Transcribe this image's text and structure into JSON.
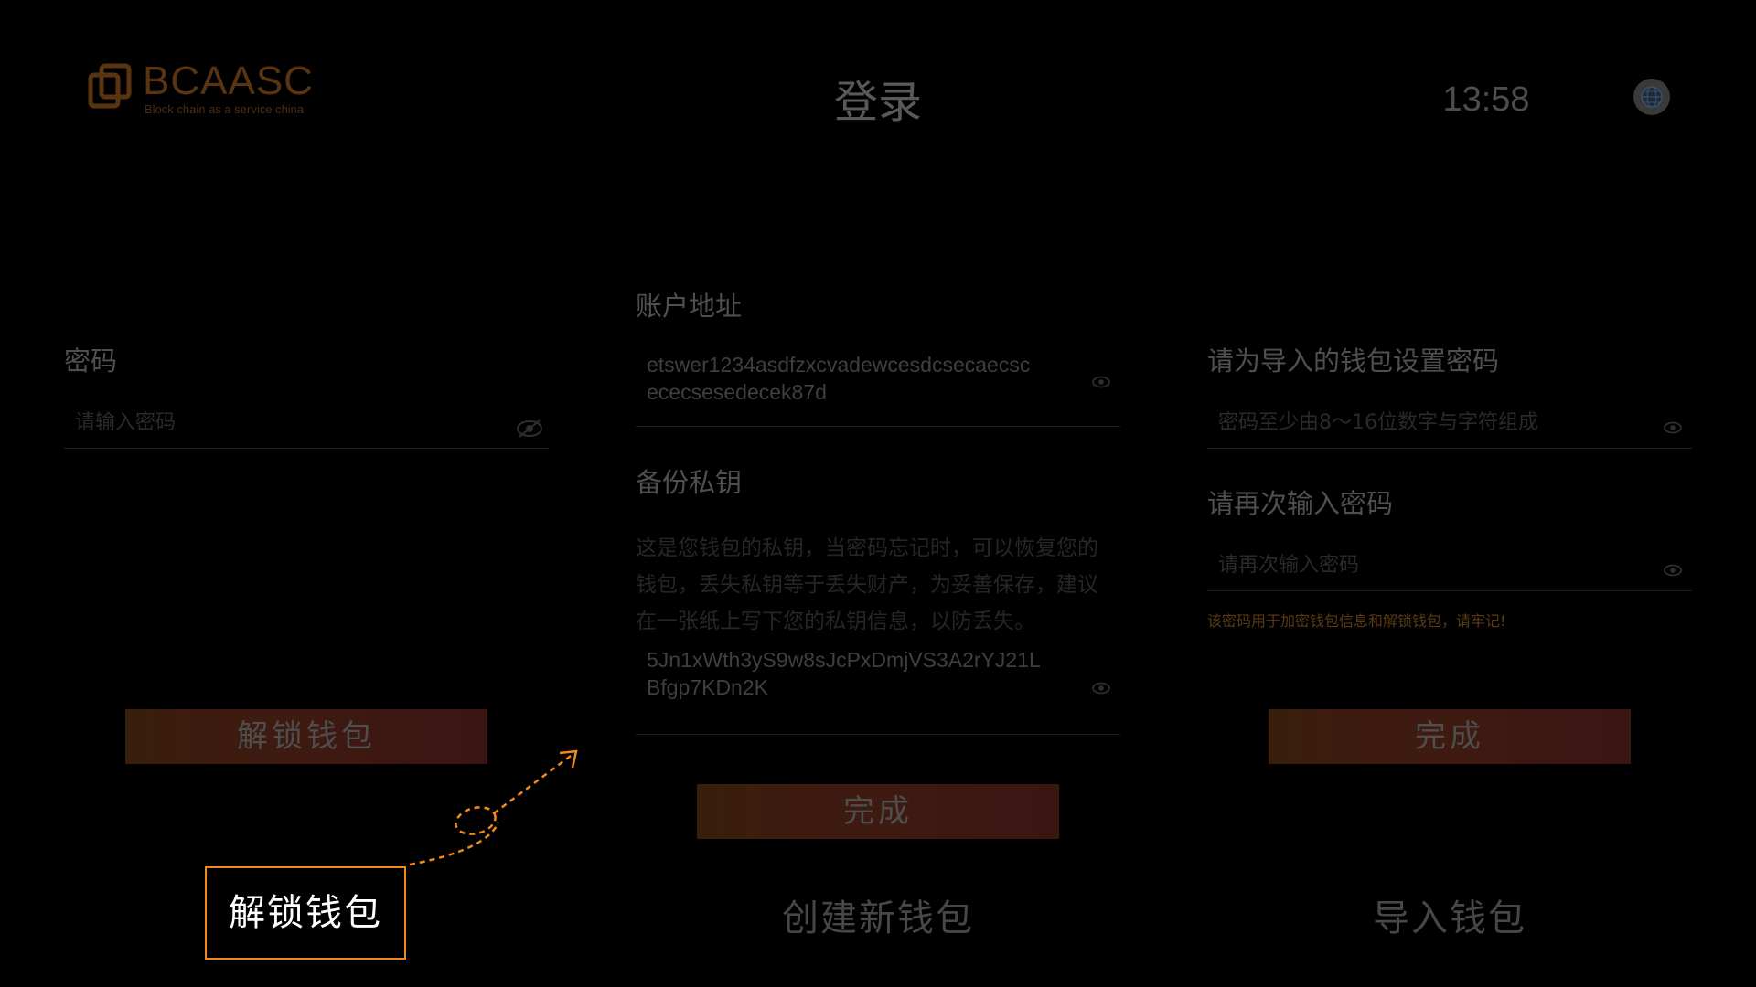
{
  "header": {
    "logo_title": "BCAASC",
    "logo_subtitle": "Block chain as a service china",
    "page_title": "登录",
    "time": "13:58",
    "language_icon": "globe-icon"
  },
  "unlock_panel": {
    "password_label": "密码",
    "password_placeholder": "请输入密码",
    "unlock_button": "解锁钱包"
  },
  "create_panel": {
    "address_label": "账户地址",
    "address_line1": "etswer1234asdfzxcvadewcesdcsecaecsc",
    "address_line2": "ececsesedecek87d",
    "backup_label": "备份私钥",
    "backup_desc_line1": "这是您钱包的私钥，当密码忘记时，可以恢复您的",
    "backup_desc_line2": "钱包，丢失私钥等于丢失财产，为妥善保存，建议",
    "backup_desc_line3": "在一张纸上写下您的私钥信息，以防丢失。",
    "private_key_line1": "5Jn1xWth3yS9w8sJcPxDmjVS3A2rYJ21L",
    "private_key_line2": "Bfgp7KDn2K",
    "done_button": "完成"
  },
  "import_panel": {
    "set_password_label": "请为导入的钱包设置密码",
    "set_password_placeholder": "密码至少由8～16位数字与字符组成",
    "confirm_label": "请再次输入密码",
    "confirm_placeholder": "请再次输入密码",
    "warning": "该密码用于加密钱包信息和解锁钱包，请牢记!",
    "done_button": "完成"
  },
  "bottom_tabs": {
    "unlock": "解锁钱包",
    "create": "创建新钱包",
    "import": "导入钱包"
  },
  "colors": {
    "background": "#000000",
    "focus_border": "#f08a1a",
    "accent_orange": "#f08a1a"
  }
}
